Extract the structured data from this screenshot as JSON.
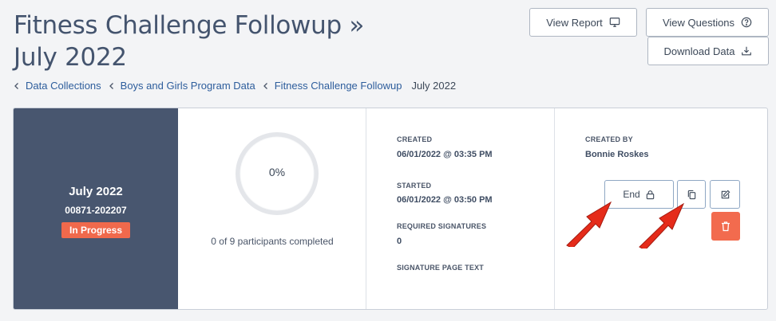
{
  "header": {
    "title": "Fitness Challenge Followup » July 2022",
    "view_report_label": "View Report",
    "view_questions_label": "View Questions",
    "download_data_label": "Download Data"
  },
  "breadcrumb": {
    "items": [
      "Data Collections",
      "Boys and Girls Program Data",
      "Fitness Challenge Followup"
    ],
    "current": "July 2022"
  },
  "summary": {
    "title": "July 2022",
    "code": "00871-202207",
    "status": "In Progress"
  },
  "progress": {
    "percent_label": "0%",
    "percent_value": 0,
    "caption": "0 of 9 participants completed"
  },
  "meta": {
    "created_label": "CREATED",
    "created_value": "06/01/2022 @ 03:35 PM",
    "started_label": "STARTED",
    "started_value": "06/01/2022 @ 03:50 PM",
    "required_signatures_label": "REQUIRED SIGNATURES",
    "required_signatures_value": "0",
    "signature_page_text_label": "SIGNATURE PAGE TEXT"
  },
  "actions": {
    "created_by_label": "CREATED BY",
    "created_by_value": "Bonnie Roskes",
    "end_label": "End"
  },
  "colors": {
    "summary_bg": "#48566f",
    "status_badge": "#f0694c",
    "delete_button": "#f26b4e",
    "link": "#2d5d9c",
    "annotation_arrow": "#e52b1a"
  }
}
